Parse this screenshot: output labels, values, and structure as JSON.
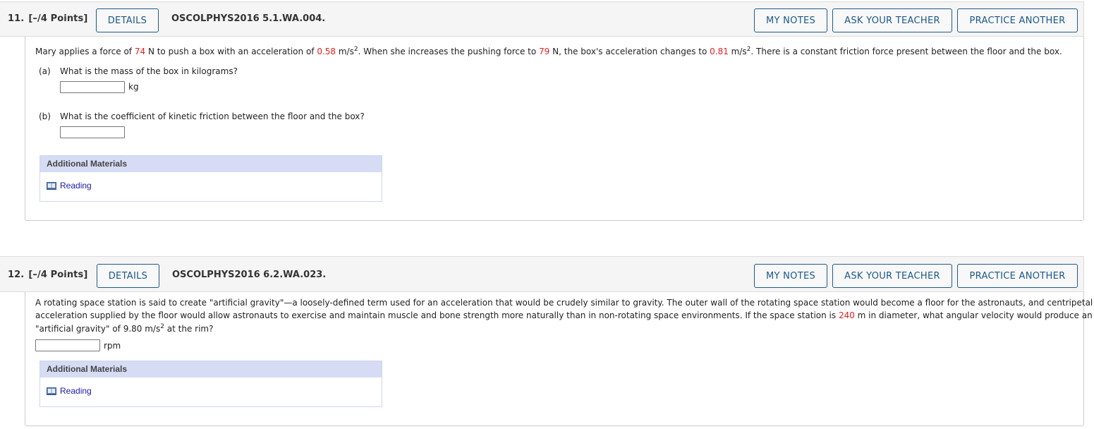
{
  "questions": [
    {
      "number": "11.",
      "points": "[–/4 Points]",
      "details_label": "DETAILS",
      "code": "OSCOLPHYS2016 5.1.WA.004.",
      "buttons": {
        "my_notes": "MY NOTES",
        "ask_teacher": "ASK YOUR TEACHER",
        "practice_another": "PRACTICE ANOTHER"
      },
      "text": {
        "t1": "Mary applies a force of ",
        "v1": "74",
        "t2": " N to push a box with an acceleration of ",
        "v2": "0.58",
        "t3": " m/s",
        "sup1": "2",
        "t4": ". When she increases the pushing force to ",
        "v3": "79",
        "t5": " N, the box's acceleration changes to ",
        "v4": "0.81",
        "t6": " m/s",
        "sup2": "2",
        "t7": ". There is a constant friction force present between the floor and the box."
      },
      "parts": [
        {
          "label": "(a)",
          "prompt": "What is the mass of the box in kilograms?",
          "value": "",
          "unit": "kg"
        },
        {
          "label": "(b)",
          "prompt": "What is the coefficient of kinetic friction between the floor and the box?",
          "value": "",
          "unit": ""
        }
      ],
      "additional_materials": {
        "title": "Additional Materials",
        "link": "Reading",
        "icon": "book-icon"
      }
    },
    {
      "number": "12.",
      "points": "[–/4 Points]",
      "details_label": "DETAILS",
      "code": "OSCOLPHYS2016 6.2.WA.023.",
      "buttons": {
        "my_notes": "MY NOTES",
        "ask_teacher": "ASK YOUR TEACHER",
        "practice_another": "PRACTICE ANOTHER"
      },
      "text": {
        "line1": "A rotating space station is said to create \"artificial gravity\"—a loosely-defined term used for an acceleration that would be crudely similar to gravity. The outer wall of the rotating space station would become a floor for the astronauts, and centripetal",
        "line2a": "acceleration supplied by the floor would allow astronauts to exercise and maintain muscle and bone strength more naturally than in non-rotating space environments. If the space station is ",
        "v1": "240",
        "line2b": " m in diameter, what angular velocity would produce an",
        "line3a": "\"artificial gravity\" of 9.80 m/s",
        "sup1": "2",
        "line3b": " at the rim?"
      },
      "answer": {
        "value": "",
        "unit": "rpm"
      },
      "additional_materials": {
        "title": "Additional Materials",
        "link": "Reading",
        "icon": "book-icon"
      }
    }
  ],
  "colors": {
    "accent": "#1a5889",
    "given_value": "#e61e1e",
    "link": "#1a1aa6",
    "materials_header": "#d5dcf4"
  }
}
